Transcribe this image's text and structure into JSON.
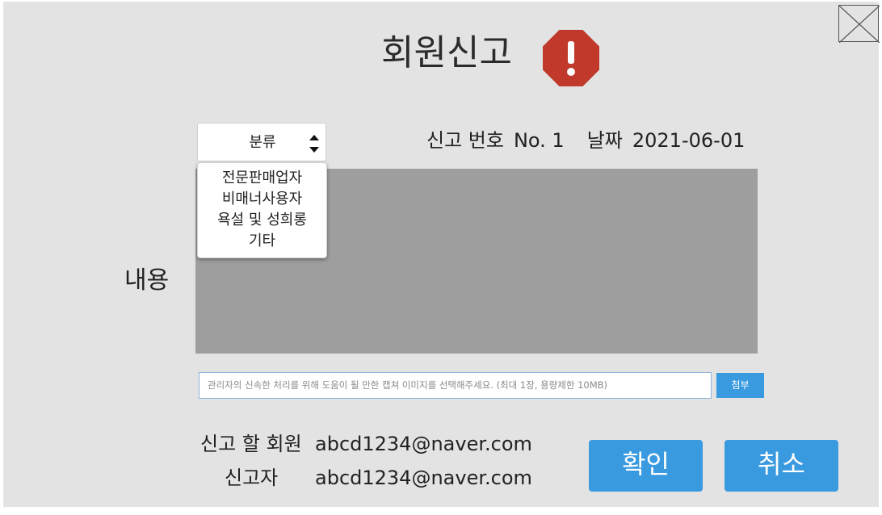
{
  "header": {
    "title": "회원신고"
  },
  "category": {
    "label": "분류",
    "options": [
      "전문판매업자",
      "비매너사용자",
      "욕설 및 성희롱",
      "기타"
    ]
  },
  "report_meta": {
    "number_label": "신고 번호",
    "number_value": "No. 1",
    "date_label": "날짜",
    "date_value": "2021-06-01"
  },
  "content": {
    "label": "내용"
  },
  "attachment": {
    "placeholder": "관리자의 신속한 처리를 위해 도움이 될 만한 캡쳐 이미지를 선택해주세요. (최대 1장, 용량제한 10MB)",
    "button_label": "첨부"
  },
  "reported_member": {
    "label": "신고 할 회원",
    "value": "abcd1234@naver.com"
  },
  "reporter": {
    "label": "신고자",
    "value": "abcd1234@naver.com"
  },
  "actions": {
    "confirm_label": "확인",
    "cancel_label": "취소"
  },
  "colors": {
    "accent": "#3a9ae0",
    "warning": "#c0392b",
    "panel": "#e3e3e3",
    "content_area": "#9e9e9e"
  }
}
